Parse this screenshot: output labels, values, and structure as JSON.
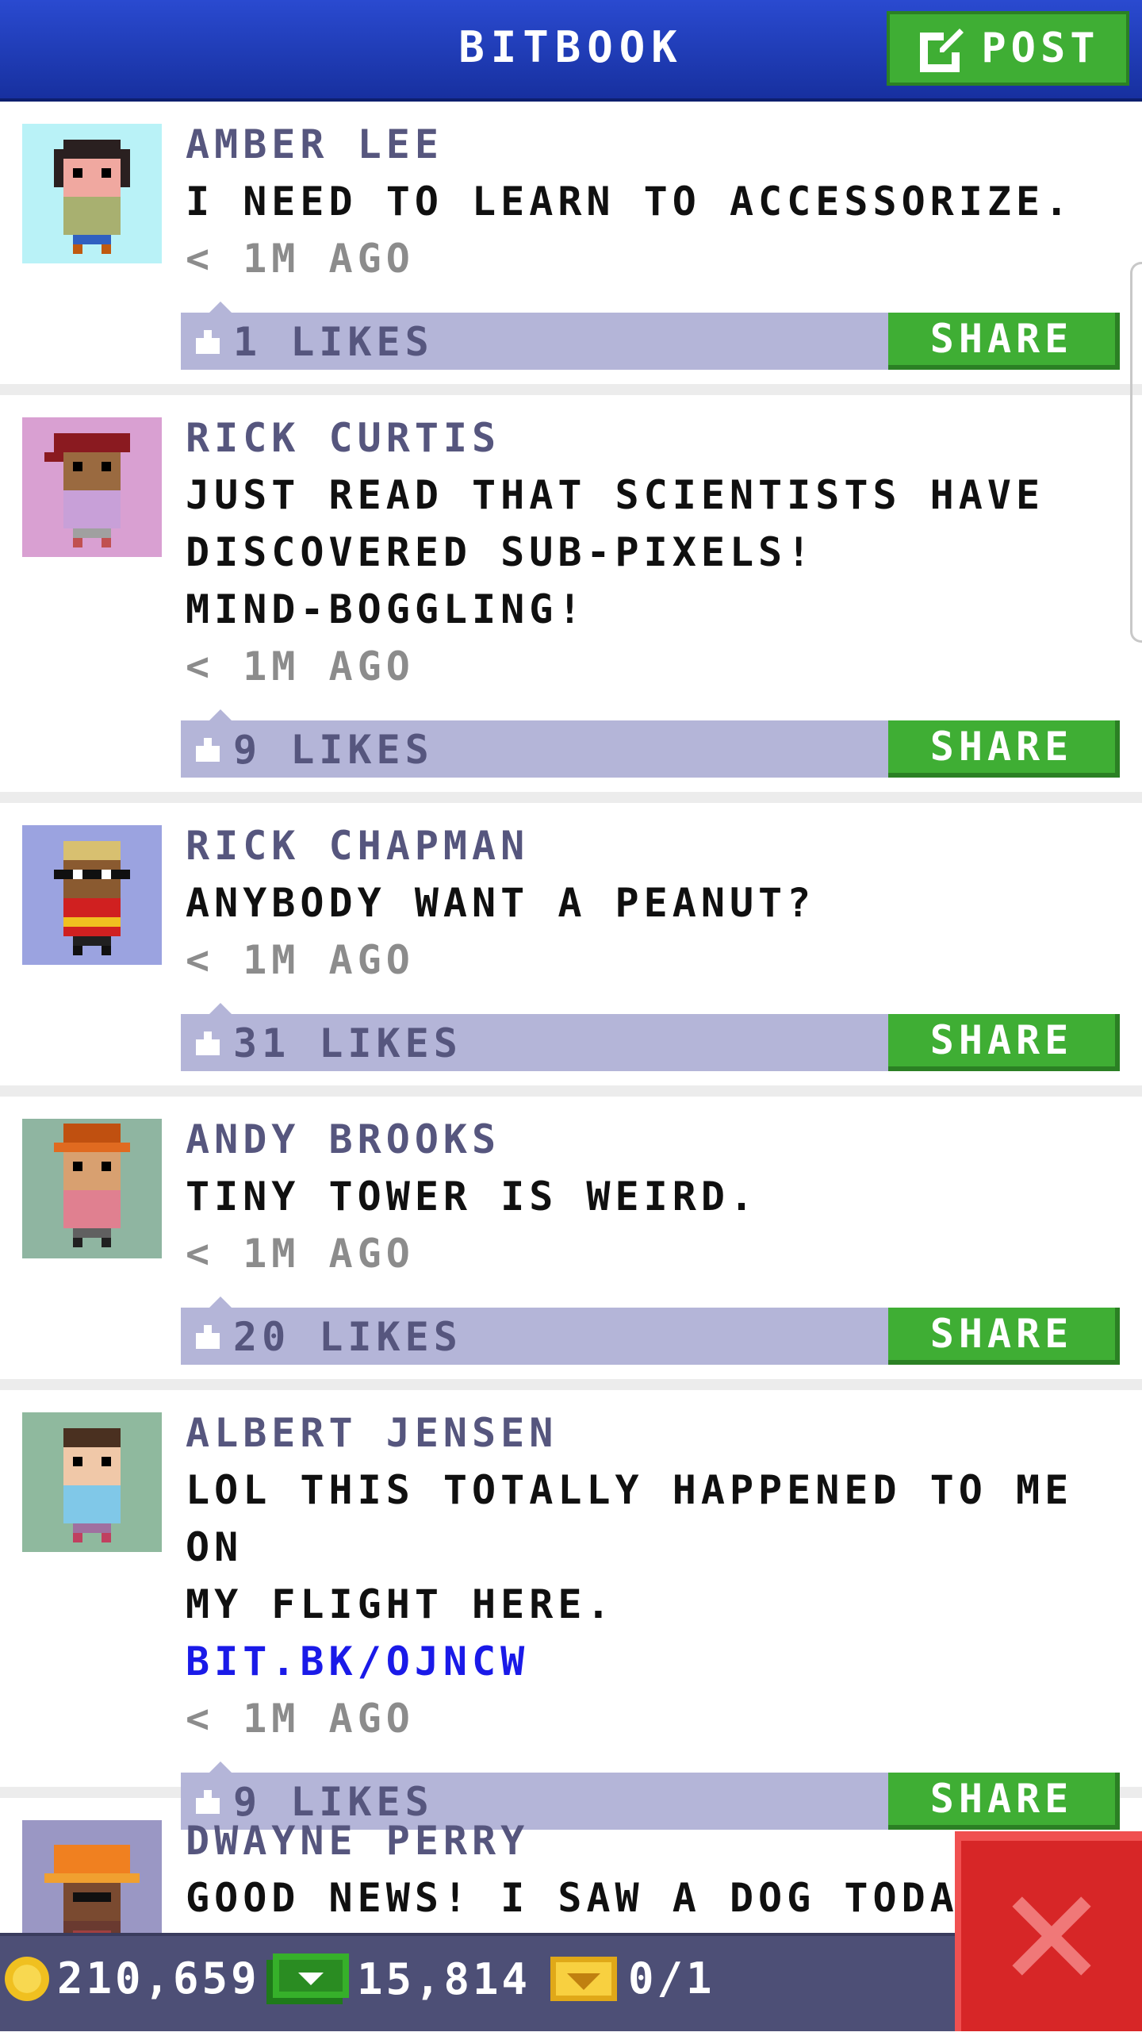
{
  "header": {
    "title": "BITBOOK",
    "post_button": {
      "label": "POST",
      "icon": "edit-icon"
    }
  },
  "feed": {
    "share_label": "SHARE",
    "posts": [
      {
        "author": "AMBER LEE",
        "lines": [
          "I NEED TO LEARN TO ACCESSORIZE."
        ],
        "link": "",
        "time": "< 1M AGO",
        "likes": "1 LIKES",
        "avatar_bg": "#b9f2f7"
      },
      {
        "author": "RICK CURTIS",
        "lines": [
          "JUST READ THAT SCIENTISTS HAVE",
          "DISCOVERED SUB-PIXELS!",
          "MIND-BOGGLING!"
        ],
        "link": "",
        "time": "< 1M AGO",
        "likes": "9 LIKES",
        "avatar_bg": "#d9a0d2"
      },
      {
        "author": "RICK CHAPMAN",
        "lines": [
          "ANYBODY WANT A PEANUT?"
        ],
        "link": "",
        "time": "< 1M AGO",
        "likes": "31 LIKES",
        "avatar_bg": "#9ba3e0"
      },
      {
        "author": "ANDY BROOKS",
        "lines": [
          "TINY TOWER IS WEIRD."
        ],
        "link": "",
        "time": "< 1M AGO",
        "likes": "20 LIKES",
        "avatar_bg": "#8fb5a1"
      },
      {
        "author": "ALBERT JENSEN",
        "lines": [
          "LOL THIS TOTALLY HAPPENED TO ME ON",
          "MY FLIGHT HERE."
        ],
        "link": "BIT.BK/OJNCW",
        "time": "< 1M AGO",
        "likes": "9 LIKES",
        "avatar_bg": "#8fb99e"
      },
      {
        "author": "DWAYNE PERRY",
        "lines": [
          "GOOD NEWS! I SAW A DOG TODAY"
        ],
        "link": "",
        "time": "",
        "likes": "",
        "avatar_bg": "#9a97c4"
      }
    ]
  },
  "bottom_bar": {
    "coins": "210,659",
    "bux": "15,814",
    "vip": "0/1"
  },
  "close_button": {
    "icon": "close-icon"
  }
}
